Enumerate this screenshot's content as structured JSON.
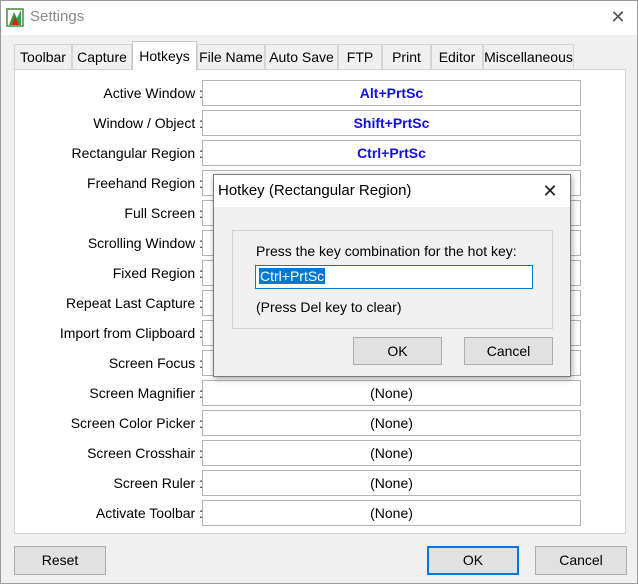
{
  "window": {
    "title": "Settings"
  },
  "tabs": [
    {
      "label": "Toolbar"
    },
    {
      "label": "Capture"
    },
    {
      "label": "Hotkeys",
      "active": true
    },
    {
      "label": "File Name"
    },
    {
      "label": "Auto Save"
    },
    {
      "label": "FTP"
    },
    {
      "label": "Print"
    },
    {
      "label": "Editor"
    },
    {
      "label": "Miscellaneous"
    }
  ],
  "hotkeys": [
    {
      "label": "Active Window :",
      "value": "Alt+PrtSc",
      "assigned": true
    },
    {
      "label": "Window / Object :",
      "value": "Shift+PrtSc",
      "assigned": true
    },
    {
      "label": "Rectangular Region :",
      "value": "Ctrl+PrtSc",
      "assigned": true
    },
    {
      "label": "Freehand Region :",
      "value": "",
      "assigned": false
    },
    {
      "label": "Full Screen :",
      "value": "",
      "assigned": false
    },
    {
      "label": "Scrolling Window :",
      "value": "",
      "assigned": false
    },
    {
      "label": "Fixed Region :",
      "value": "",
      "assigned": false
    },
    {
      "label": "Repeat Last Capture :",
      "value": "",
      "assigned": false
    },
    {
      "label": "Import from Clipboard :",
      "value": "",
      "assigned": false
    },
    {
      "label": "Screen Focus :",
      "value": "",
      "assigned": false
    },
    {
      "label": "Screen Magnifier :",
      "value": "(None)",
      "assigned": false
    },
    {
      "label": "Screen Color Picker :",
      "value": "(None)",
      "assigned": false
    },
    {
      "label": "Screen Crosshair :",
      "value": "(None)",
      "assigned": false
    },
    {
      "label": "Screen Ruler :",
      "value": "(None)",
      "assigned": false
    },
    {
      "label": "Activate Toolbar :",
      "value": "(None)",
      "assigned": false
    }
  ],
  "buttons": {
    "reset": "Reset",
    "ok": "OK",
    "cancel": "Cancel"
  },
  "dialog": {
    "title": "Hotkey (Rectangular Region)",
    "prompt": "Press the key combination for the hot key:",
    "input_value": "Ctrl+PrtSc",
    "hint": "(Press Del key to clear)",
    "ok_label": "OK",
    "cancel_label": "Cancel"
  },
  "colors": {
    "assigned_hotkey": "#1010e0",
    "selection": "#0078d7"
  },
  "icons": {
    "app": "app-logo-icon",
    "close": "close-icon"
  }
}
